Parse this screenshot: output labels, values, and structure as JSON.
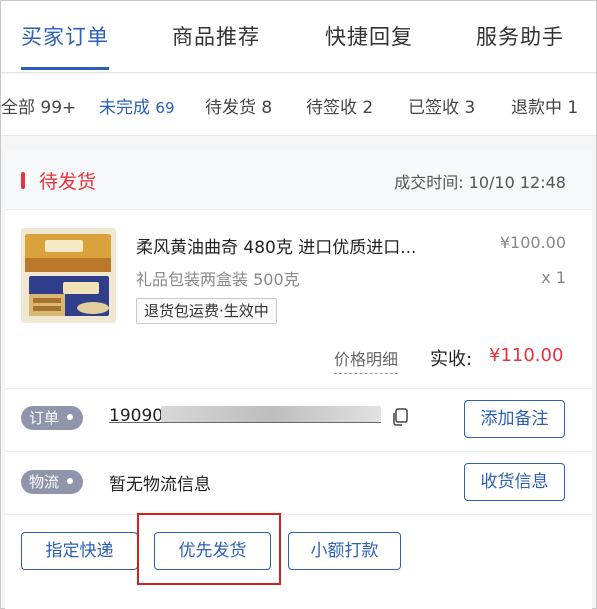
{
  "tabs": [
    {
      "label": "买家订单",
      "active": true
    },
    {
      "label": "商品推荐",
      "active": false
    },
    {
      "label": "快捷回复",
      "active": false
    },
    {
      "label": "服务助手",
      "active": false
    }
  ],
  "filters": [
    {
      "label": "全部",
      "count": "99+",
      "active": false
    },
    {
      "label": "未完成",
      "count": "69",
      "active": true
    },
    {
      "label": "待发货",
      "count": "8",
      "active": false
    },
    {
      "label": "待签收",
      "count": "2",
      "active": false
    },
    {
      "label": "已签收",
      "count": "3",
      "active": false
    },
    {
      "label": "退款中",
      "count": "1",
      "active": false
    }
  ],
  "order": {
    "status": "待发货",
    "deal_time": "成交时间: 10/10 12:48",
    "product": {
      "title": "柔风黄油曲奇 480克 进口优质进口...",
      "sku": "礼品包装两盒装 500克",
      "tag": "退货包运费·生效中",
      "price": "¥100.00",
      "quantity": "x 1"
    },
    "price_detail_label": "价格明细",
    "paid_label": "实收:",
    "paid_value": "¥110.00",
    "order_label": "订单",
    "order_number": "19090",
    "add_note_button": "添加备注",
    "logistics_label": "物流",
    "logistics_text": "暂无物流信息",
    "shipping_info_button": "收货信息",
    "actions": [
      "指定快递",
      "优先发货",
      "小额打款"
    ]
  },
  "colors": {
    "accent": "#2c5fb8",
    "status_red": "#e8323c",
    "highlight": "#d62020"
  }
}
